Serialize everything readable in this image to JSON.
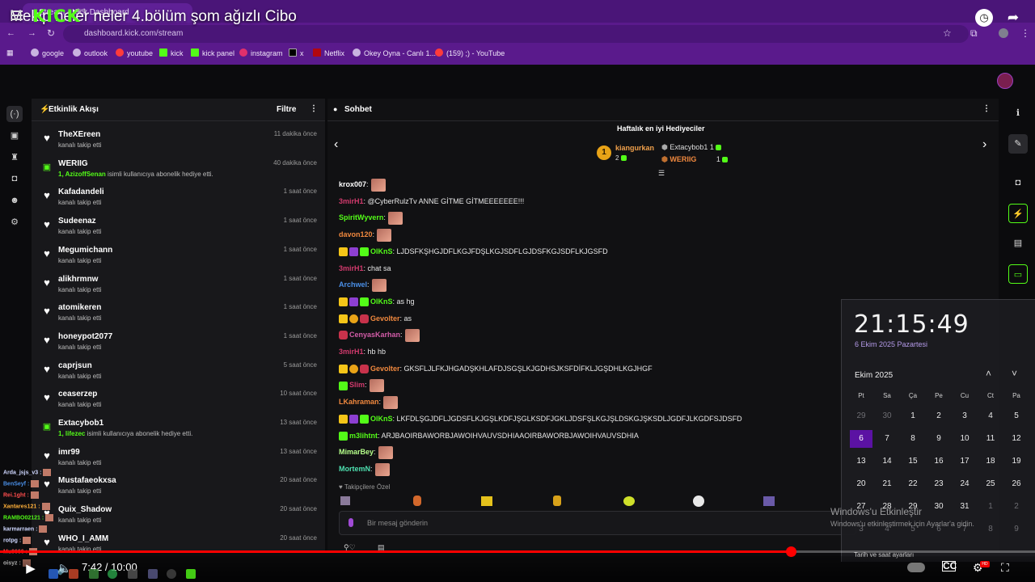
{
  "video": {
    "title": "Mekip neler neler 4.bölüm şom ağızlı Cibo",
    "time_current": "7:42",
    "time_total": "10:00",
    "time_label": "7:42 / 10:00",
    "progress": 0.764
  },
  "browser": {
    "tab_title": "Stream - Kick Dashboard",
    "url": "dashboard.kick.com/stream",
    "bookmarks": [
      "google",
      "outlook",
      "youtube",
      "kick",
      "kick panel",
      "instagram",
      "x",
      "Netflix",
      "Okey Oyna - Canlı 1...",
      "(159) ;) - YouTube"
    ]
  },
  "kick": {
    "logo": "KICK",
    "beta": "BETA"
  },
  "activity": {
    "title": "Etkinlik Akışı",
    "filter": "Filtre",
    "items": [
      {
        "name": "TheXEreen",
        "sub": "kanalı takip etti",
        "time": "11 dakika önce",
        "type": "follow"
      },
      {
        "name": "WERIIG",
        "sub_bold": "1, AzizoffSenan",
        "sub": " isimli kullanıcıya abonelik hediye etti.",
        "time": "40 dakika önce",
        "type": "gift"
      },
      {
        "name": "Kafadandeli",
        "sub": "kanalı takip etti",
        "time": "1 saat önce",
        "type": "follow"
      },
      {
        "name": "Sudeenaz",
        "sub": "kanalı takip etti",
        "time": "1 saat önce",
        "type": "follow"
      },
      {
        "name": "Megumichann",
        "sub": "kanalı takip etti",
        "time": "1 saat önce",
        "type": "follow"
      },
      {
        "name": "alikhrmnw",
        "sub": "kanalı takip etti",
        "time": "1 saat önce",
        "type": "follow"
      },
      {
        "name": "atomikeren",
        "sub": "kanalı takip etti",
        "time": "1 saat önce",
        "type": "follow"
      },
      {
        "name": "honeypot2077",
        "sub": "kanalı takip etti",
        "time": "1 saat önce",
        "type": "follow"
      },
      {
        "name": "caprjsun",
        "sub": "kanalı takip etti",
        "time": "5 saat önce",
        "type": "follow"
      },
      {
        "name": "ceaserzep",
        "sub": "kanalı takip etti",
        "time": "10 saat önce",
        "type": "follow"
      },
      {
        "name": "Extacybob1",
        "sub_bold": "1, lifezec",
        "sub": " isimli kullanıcıya abonelik hediye etti.",
        "time": "13 saat önce",
        "type": "gift"
      },
      {
        "name": "imr99",
        "sub": "kanalı takip etti",
        "time": "13 saat önce",
        "type": "follow"
      },
      {
        "name": "Mustafaeokxsa",
        "sub": "kanalı takip etti",
        "time": "20 saat önce",
        "type": "follow"
      },
      {
        "name": "Quix_Shadow",
        "sub": "kanalı takip etti",
        "time": "20 saat önce",
        "type": "follow"
      },
      {
        "name": "WHO_I_AMM",
        "sub": "kanalı takip etti",
        "time": "20 saat önce",
        "type": "follow"
      }
    ]
  },
  "chat": {
    "title": "Sohbet",
    "gifters_title": "Haftalık en iyi Hediyeciler",
    "gifters": [
      {
        "name": "kiangurkan",
        "count": "2",
        "rank": "1"
      },
      {
        "name": "Extacybob1",
        "count": "1"
      },
      {
        "name": "WERIIG",
        "count": "1"
      }
    ],
    "messages": [
      {
        "user": "krox007",
        "color": "#ffffff",
        "text": "",
        "emote": true
      },
      {
        "user": "3mirH1",
        "color": "#d23a6d",
        "text": "@CyberRulzTv ANNE GİTME GİTMEEEEEEE!!!",
        "emote": false
      },
      {
        "user": "SpiritWyvern",
        "color": "#53fc18",
        "text": "",
        "emote": true
      },
      {
        "user": "davon120",
        "color": "#f0883e",
        "text": "",
        "emote": true
      },
      {
        "user": "OlKnS",
        "color": "#53fc18",
        "text": "LJDSFKŞHGJDFLKGJFDŞLKGJSDFLGJDSFKGJSDFLKJGSFD",
        "emote": false,
        "badges": [
          "crown",
          "purple",
          "green"
        ]
      },
      {
        "user": "3mirH1",
        "color": "#d23a6d",
        "text": "chat sa",
        "emote": false
      },
      {
        "user": "Archwel",
        "color": "#4a8fe7",
        "text": "",
        "emote": true
      },
      {
        "user": "OlKnS",
        "color": "#53fc18",
        "text": "as hg",
        "emote": false,
        "badges": [
          "crown",
          "purple",
          "green"
        ]
      },
      {
        "user": "Gevolter",
        "color": "#f0883e",
        "text": "as",
        "emote": false,
        "badges": [
          "crown",
          "coin",
          "red"
        ]
      },
      {
        "user": "CenyasKarhan",
        "color": "#d25ca7",
        "text": "",
        "emote": true,
        "badges": [
          "red"
        ]
      },
      {
        "user": "3mirH1",
        "color": "#d23a6d",
        "text": "hb hb",
        "emote": false
      },
      {
        "user": "Gevolter",
        "color": "#f0883e",
        "text": "GKSFLJLFKJHGADŞKHLAFDJSGŞLKJGDHSJKSFDİFKLJGŞDHLKGJHGF",
        "emote": false,
        "badges": [
          "crown",
          "coin",
          "red"
        ]
      },
      {
        "user": "Slim",
        "color": "#d23a6d",
        "text": "",
        "emote": true,
        "badges": [
          "green"
        ]
      },
      {
        "user": "LKahraman",
        "color": "#f0883e",
        "text": "",
        "emote": true
      },
      {
        "user": "OlKnS",
        "color": "#53fc18",
        "text": "LKFDLŞGJDFLJGDSFLKJGŞLKDFJŞGLKSDFJGKLJDSFŞLKGJŞLDSKGJŞKSDLJGDFJLKGDFSJDSFD",
        "emote": false,
        "badges": [
          "crown",
          "purple",
          "green"
        ]
      },
      {
        "user": "m3lihtnt",
        "color": "#53fc18",
        "text": "ARJBAOIRBAWORBJAWOIHVAUVSDHIAAOIRBAWORBJAWOIHVAUVSDHIA",
        "emote": false,
        "badges": [
          "green"
        ]
      },
      {
        "user": "MimarBey",
        "color": "#b6ff8a",
        "text": "",
        "emote": true
      },
      {
        "user": "MortemN",
        "color": "#4ee0b0",
        "text": "",
        "emote": true
      }
    ],
    "followers_only": "Takipçilere Özel",
    "input_placeholder": "Bir mesaj gönderin"
  },
  "calendar": {
    "time": "21:15:49",
    "date": "6 Ekim 2025 Pazartesi",
    "month": "Ekim 2025",
    "weekdays": [
      "Pt",
      "Sa",
      "Ça",
      "Pe",
      "Cu",
      "Ct",
      "Pa"
    ],
    "rows": [
      [
        "29",
        "30",
        "1",
        "2",
        "3",
        "4",
        "5"
      ],
      [
        "6",
        "7",
        "8",
        "9",
        "10",
        "11",
        "12"
      ],
      [
        "13",
        "14",
        "15",
        "16",
        "17",
        "18",
        "19"
      ],
      [
        "20",
        "21",
        "22",
        "23",
        "24",
        "25",
        "26"
      ],
      [
        "27",
        "28",
        "29",
        "30",
        "31",
        "1",
        "2"
      ],
      [
        "3",
        "4",
        "5",
        "6",
        "7",
        "8",
        "9"
      ]
    ],
    "today": "6",
    "footer": "Tarih ve saat ayarları"
  },
  "activation": {
    "title": "Windows'u Etkinleştir",
    "subtitle": "Windows'u etkinleştirmek için Ayarlar'a gidin."
  },
  "overlay_chat": [
    {
      "name": "Arda_jsjs_v3 :",
      "color": "#cfd7ff"
    },
    {
      "name": "BenSeyf :",
      "color": "#4a8fe7"
    },
    {
      "name": "Rei.1ght :",
      "color": "#ff4d4d"
    },
    {
      "name": "Xantares121 :",
      "color": "#ffb03a"
    },
    {
      "name": "RAMBO02121 :",
      "color": "#53fc18"
    },
    {
      "name": "karmarraen :",
      "color": "#cfd7ff"
    },
    {
      "name": "rotpg :",
      "color": "#cfd7ff"
    },
    {
      "name": "Mu0666 :",
      "color": "#ff4d4d"
    },
    {
      "name": "oisyz :",
      "color": "#ffffff"
    }
  ]
}
